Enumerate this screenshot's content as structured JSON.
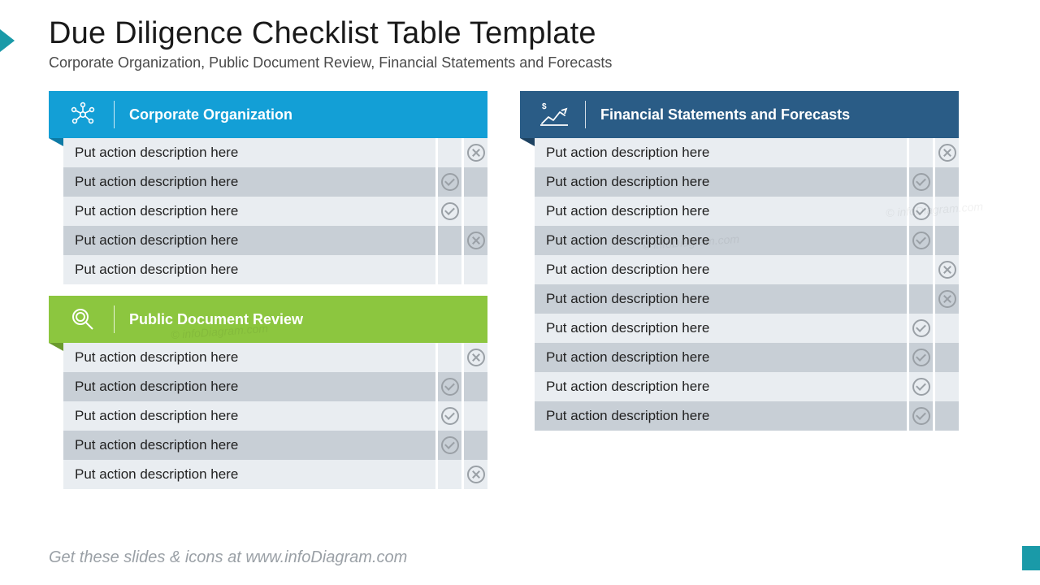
{
  "title": "Due Diligence Checklist Table Template",
  "subtitle": "Corporate Organization, Public Document Review, Financial Statements and Forecasts",
  "footer": "Get these slides & icons at www.infoDiagram.com",
  "watermark": "© infoDiagram.com",
  "row_label": "Put action description here",
  "sections": {
    "corporate": {
      "title": "Corporate Organization",
      "rows": [
        {
          "check": false,
          "cross": true
        },
        {
          "check": true,
          "cross": false
        },
        {
          "check": true,
          "cross": false
        },
        {
          "check": false,
          "cross": true
        },
        {
          "check": false,
          "cross": false
        }
      ]
    },
    "public": {
      "title": "Public Document Review",
      "rows": [
        {
          "check": false,
          "cross": true
        },
        {
          "check": true,
          "cross": false
        },
        {
          "check": true,
          "cross": false
        },
        {
          "check": true,
          "cross": false
        },
        {
          "check": false,
          "cross": true
        }
      ]
    },
    "financial": {
      "title": "Financial Statements and Forecasts",
      "rows": [
        {
          "check": false,
          "cross": true
        },
        {
          "check": true,
          "cross": false
        },
        {
          "check": true,
          "cross": false
        },
        {
          "check": true,
          "cross": false
        },
        {
          "check": false,
          "cross": true
        },
        {
          "check": false,
          "cross": true
        },
        {
          "check": true,
          "cross": false
        },
        {
          "check": true,
          "cross": false
        },
        {
          "check": true,
          "cross": false
        },
        {
          "check": true,
          "cross": false
        }
      ]
    }
  }
}
